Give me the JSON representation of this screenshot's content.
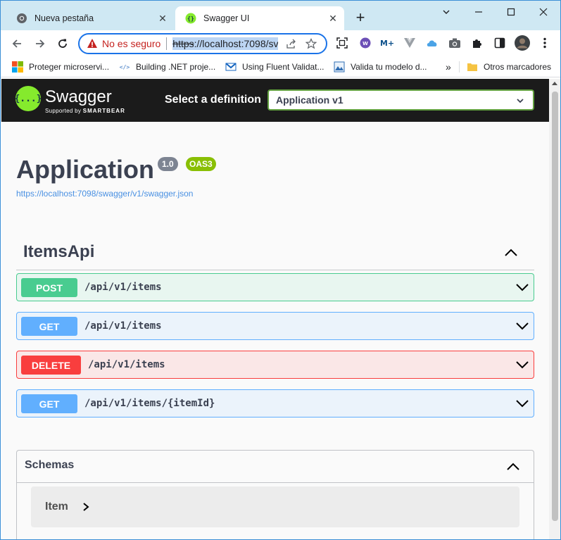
{
  "browser": {
    "tabs": [
      {
        "title": "Nueva pestaña",
        "icon": "chrome-icon",
        "active": false
      },
      {
        "title": "Swagger UI",
        "icon": "swagger-favicon",
        "active": true
      }
    ],
    "new_tab_label": "+",
    "address": {
      "security_text": "No es seguro",
      "url_scheme": "https",
      "url_rest": "://localhost:7098/sv"
    },
    "bookmarks": [
      {
        "label": "Proteger microservi...",
        "icon": "microsoft-icon"
      },
      {
        "label": "Building .NET proje...",
        "icon": "code-icon"
      },
      {
        "label": "Using Fluent Validat...",
        "icon": "gmail-icon"
      },
      {
        "label": "Valida tu modelo d...",
        "icon": "image-icon"
      }
    ],
    "bookmarks_overflow": "»",
    "other_bookmarks": "Otros marcadores"
  },
  "swagger": {
    "brand": "Swagger",
    "brand_sub_prefix": "Supported by",
    "brand_sub_company": "SMARTBEAR",
    "logo_text": "{...}",
    "select_label": "Select a definition",
    "selected_definition": "Application v1",
    "info": {
      "title": "Application",
      "version": "1.0",
      "oas": "OAS3",
      "spec_url": "https://localhost:7098/swagger/v1/swagger.json"
    },
    "tag": "ItemsApi",
    "operations": [
      {
        "method": "POST",
        "path": "/api/v1/items"
      },
      {
        "method": "GET",
        "path": "/api/v1/items"
      },
      {
        "method": "DELETE",
        "path": "/api/v1/items"
      },
      {
        "method": "GET",
        "path": "/api/v1/items/{itemId}"
      }
    ],
    "schemas_title": "Schemas",
    "schemas": [
      "Item"
    ]
  },
  "colors": {
    "post": "#49cc90",
    "get": "#61affe",
    "delete": "#f93e3e",
    "swagger_green": "#85ea2d",
    "topbar": "#1b1b1b"
  }
}
